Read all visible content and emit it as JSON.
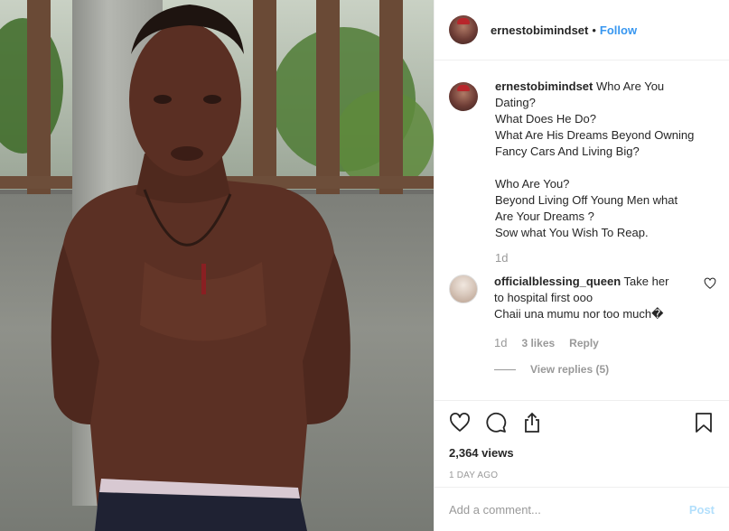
{
  "post": {
    "author": "ernestobimindset",
    "header_separator": "•",
    "follow_label": "Follow",
    "caption_lines": [
      "Who Are You",
      "Dating?",
      "What Does He Do?",
      "What Are His Dreams Beyond Owning",
      "Fancy Cars And Living Big?",
      "",
      "Who Are You?",
      "Beyond Living Off Young Men what",
      "Are Your Dreams ?",
      "Sow what You Wish To Reap."
    ],
    "caption_time": "1d"
  },
  "comment": {
    "username": "officialblessing_queen",
    "text_line1": "Take her",
    "text_line2": "to hospital first ooo",
    "text_line3": "Chaii una mumu nor too much�",
    "time": "1d",
    "likes": "3 likes",
    "reply_label": "Reply",
    "view_replies": "View replies (5)"
  },
  "stats": {
    "views": "2,364 views",
    "date": "1 DAY AGO"
  },
  "add_comment": {
    "placeholder": "Add a comment...",
    "post_label": "Post"
  },
  "icons": {
    "like": "heart-icon",
    "comment": "comment-icon",
    "share": "share-icon",
    "save": "bookmark-icon",
    "comment_like": "small-heart-icon"
  },
  "colors": {
    "accent": "#3897f0",
    "muted": "#999999",
    "text": "#262626",
    "post_disabled": "#b2dffc"
  }
}
